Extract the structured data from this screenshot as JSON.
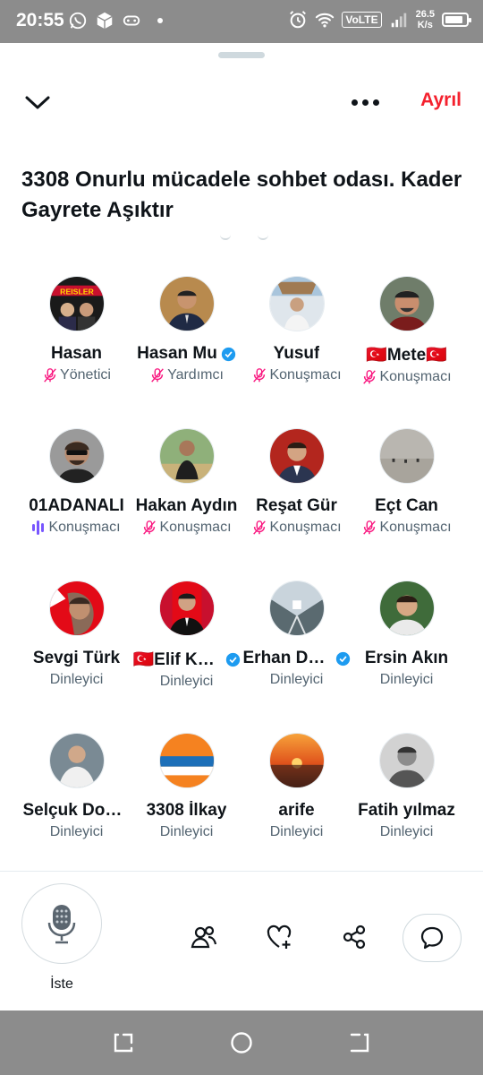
{
  "status_bar": {
    "time": "20:55",
    "network_badge": "VoLTE",
    "speed_value": "26.5",
    "speed_unit": "K/s",
    "battery_level": 0.85,
    "icons": [
      "whatsapp-icon",
      "package-icon",
      "gamepad-icon",
      "dot-icon",
      "alarm-icon",
      "wifi-icon",
      "volte-icon",
      "signal-icon",
      "battery-icon"
    ]
  },
  "header": {
    "collapse_icon": "chevron-down-icon",
    "more_icon": "more-icon",
    "leave_label": "Ayrıl"
  },
  "space": {
    "title": "3308 Onurlu mücadele sohbet odası. Kader Gayrete Aşıktır"
  },
  "participants": [
    {
      "name": "Hasan",
      "role": "Yönetici",
      "role_icon": "mic-off-icon",
      "verified": false
    },
    {
      "name": "Hasan Mu",
      "role": "Yardımcı",
      "role_icon": "mic-off-icon",
      "verified": true
    },
    {
      "name": "Yusuf",
      "role": "Konuşmacı",
      "role_icon": "mic-off-icon",
      "verified": false
    },
    {
      "name": "🇹🇷Mete🇹🇷",
      "role": "Konuşmacı",
      "role_icon": "mic-off-icon",
      "verified": false
    },
    {
      "name": "01ADANALI",
      "role": "Konuşmacı",
      "role_icon": "speaking-icon",
      "verified": false
    },
    {
      "name": "Hakan Aydın",
      "role": "Konuşmacı",
      "role_icon": "mic-off-icon",
      "verified": false
    },
    {
      "name": "Reşat Gür",
      "role": "Konuşmacı",
      "role_icon": "mic-off-icon",
      "verified": false
    },
    {
      "name": "Eçt Can",
      "role": "Konuşmacı",
      "role_icon": "mic-off-icon",
      "verified": false
    },
    {
      "name": "Sevgi Türk",
      "role": "Dinleyici",
      "role_icon": "",
      "verified": false
    },
    {
      "name": "🇹🇷Elif Kaya",
      "role": "Dinleyici",
      "role_icon": "",
      "verified": true
    },
    {
      "name": "Erhan Demir",
      "role": "Dinleyici",
      "role_icon": "",
      "verified": true
    },
    {
      "name": "Ersin Akın",
      "role": "Dinleyici",
      "role_icon": "",
      "verified": false
    },
    {
      "name": "Selçuk Doğan",
      "role": "Dinleyici",
      "role_icon": "",
      "verified": false
    },
    {
      "name": "3308 İlkay",
      "role": "Dinleyici",
      "role_icon": "",
      "verified": false
    },
    {
      "name": "arife",
      "role": "Dinleyici",
      "role_icon": "",
      "verified": false
    },
    {
      "name": "Fatih yılmaz",
      "role": "Dinleyici",
      "role_icon": "",
      "verified": false
    }
  ],
  "bottom_bar": {
    "mic_label": "İste",
    "actions": [
      "people-icon",
      "heart-plus-icon",
      "share-icon",
      "chat-bubble-icon"
    ]
  },
  "nav_bar": {
    "buttons": [
      "recents-icon",
      "home-circle-icon",
      "back-icon"
    ]
  },
  "colors": {
    "accent_red": "#f4212e",
    "verified_blue": "#1d9bf0",
    "mic_off_pink": "#f91880",
    "speaking_purple": "#7856ff",
    "secondary_text": "#536471"
  }
}
